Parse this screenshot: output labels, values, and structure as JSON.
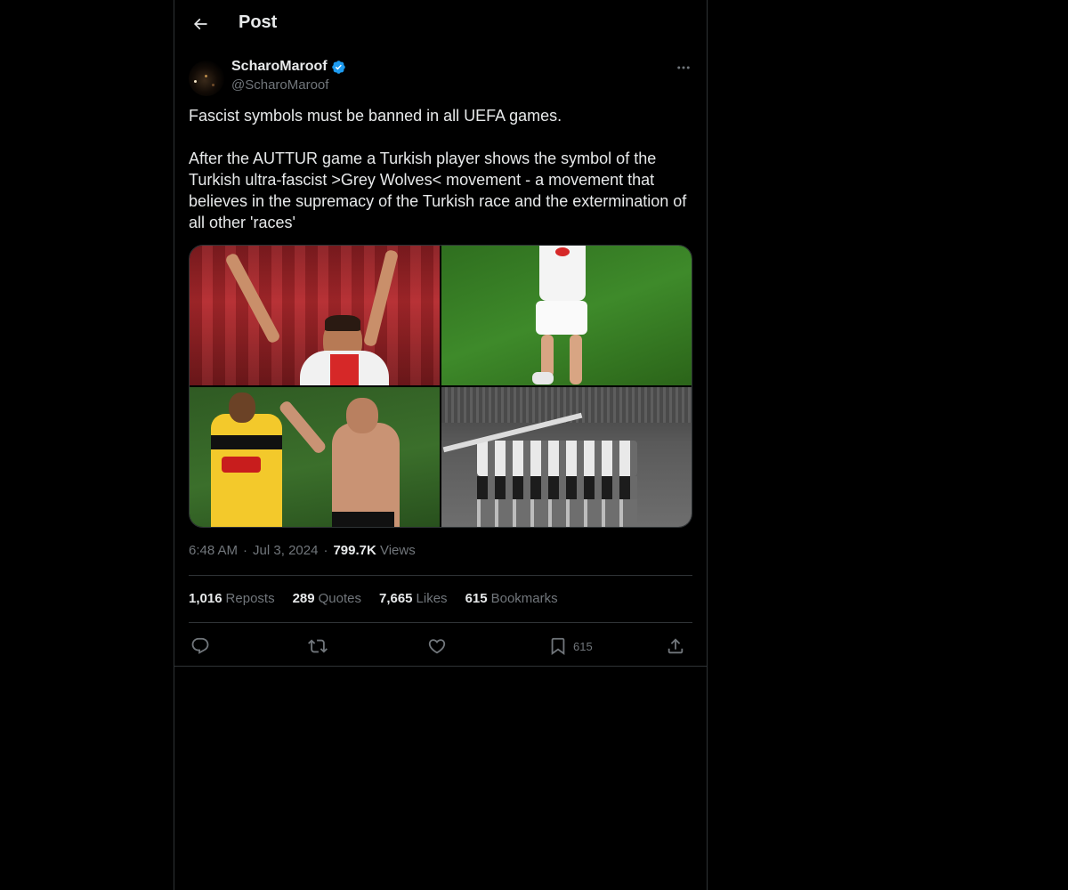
{
  "header": {
    "back_icon": "arrow-left-icon",
    "title": "Post"
  },
  "author": {
    "display_name": "ScharoMaroof",
    "verified": true,
    "verified_color": "#1d9bf0",
    "handle": "@ScharoMaroof"
  },
  "tweet": {
    "paragraphs": [
      "Fascist symbols must be banned in all UEFA games.",
      "After the AUTTUR game a Turkish player shows the symbol of the Turkish ultra-fascist >Grey Wolves< movement - a movement that believes in the supremacy of the Turkish race and the extermination of all other 'races'"
    ],
    "media_count": 4
  },
  "meta": {
    "time": "6:48 AM",
    "separator": "·",
    "date": "Jul 3, 2024",
    "views_count": "799.7K",
    "views_label": "Views"
  },
  "stats": {
    "reposts_count": "1,016",
    "reposts_label": "Reposts",
    "quotes_count": "289",
    "quotes_label": "Quotes",
    "likes_count": "7,665",
    "likes_label": "Likes",
    "bookmarks_count": "615",
    "bookmarks_label": "Bookmarks"
  },
  "actions": {
    "reply_icon": "reply-icon",
    "repost_icon": "repost-icon",
    "like_icon": "heart-icon",
    "bookmark_icon": "bookmark-icon",
    "bookmark_count": "615",
    "share_icon": "share-icon"
  },
  "colors": {
    "background": "#000000",
    "text_primary": "#e7e9ea",
    "text_secondary": "#71767b",
    "border": "#2f3336",
    "accent": "#1d9bf0"
  }
}
